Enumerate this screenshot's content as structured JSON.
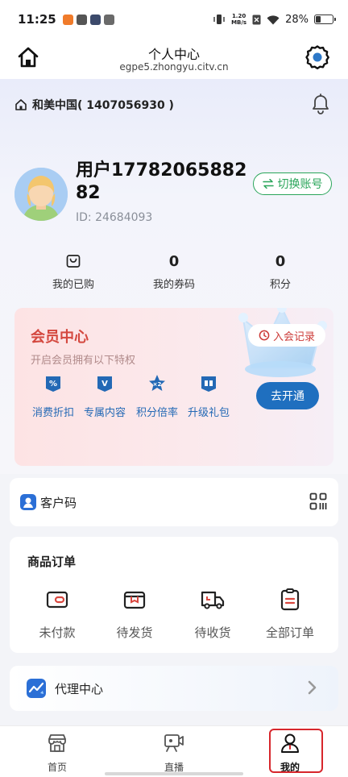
{
  "status_bar": {
    "time": "11:25",
    "net_speed_value": "1.20",
    "net_speed_unit": "MB/s",
    "battery": "28%",
    "battery_level": 0.28
  },
  "header": {
    "title": "个人中心",
    "domain": "egpe5.zhongyu.citv.cn",
    "home_icon": "home-icon",
    "settings_icon": "gear-icon"
  },
  "org": {
    "name": "和美中国( 1407056930 )"
  },
  "profile": {
    "username": "用户1778206588282",
    "user_id": "ID: 24684093",
    "switch_label": "切换账号"
  },
  "stats": [
    {
      "value": "",
      "label": "我的已购",
      "icon": "purchase-icon"
    },
    {
      "value": "0",
      "label": "我的券码"
    },
    {
      "value": "0",
      "label": "积分"
    }
  ],
  "member": {
    "title": "会员中心",
    "subtitle": "开启会员拥有以下特权",
    "records_label": "入会记录",
    "open_label": "去开通",
    "perks": [
      {
        "label": "消费折扣",
        "icon": "discount-icon"
      },
      {
        "label": "专属内容",
        "icon": "vip-content-icon"
      },
      {
        "label": "积分倍率",
        "icon": "points-multiplier-icon"
      },
      {
        "label": "升级礼包",
        "icon": "gift-icon"
      }
    ]
  },
  "customer_code": {
    "label": "客户码"
  },
  "orders": {
    "title": "商品订单",
    "items": [
      {
        "label": "未付款",
        "icon": "wallet-icon"
      },
      {
        "label": "待发货",
        "icon": "package-icon"
      },
      {
        "label": "待收货",
        "icon": "truck-icon"
      },
      {
        "label": "全部订单",
        "icon": "order-list-icon"
      }
    ]
  },
  "agent": {
    "label": "代理中心"
  },
  "nav": {
    "items": [
      {
        "label": "首页",
        "icon": "store-icon"
      },
      {
        "label": "直播",
        "icon": "live-camera-icon"
      },
      {
        "label": "我的",
        "icon": "person-icon"
      }
    ],
    "active_index": 2
  },
  "colors": {
    "accent_green": "#2aa55a",
    "member_red": "#d4483f",
    "perk_blue": "#2369b5",
    "open_button": "#1f6fbf",
    "highlight_red": "#d7262c"
  }
}
